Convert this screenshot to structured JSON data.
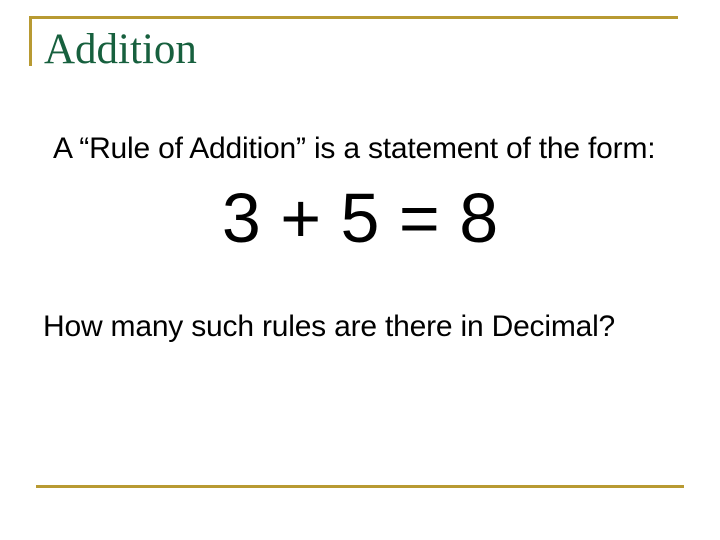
{
  "slide": {
    "title": "Addition",
    "intro_text": "A “Rule of Addition” is a statement of the form:",
    "equation": "3 + 5 = 8",
    "question": "How many such rules are there in Decimal?"
  },
  "theme": {
    "accent_color": "#B89A32",
    "title_color": "#17603E",
    "text_color": "#000000"
  }
}
